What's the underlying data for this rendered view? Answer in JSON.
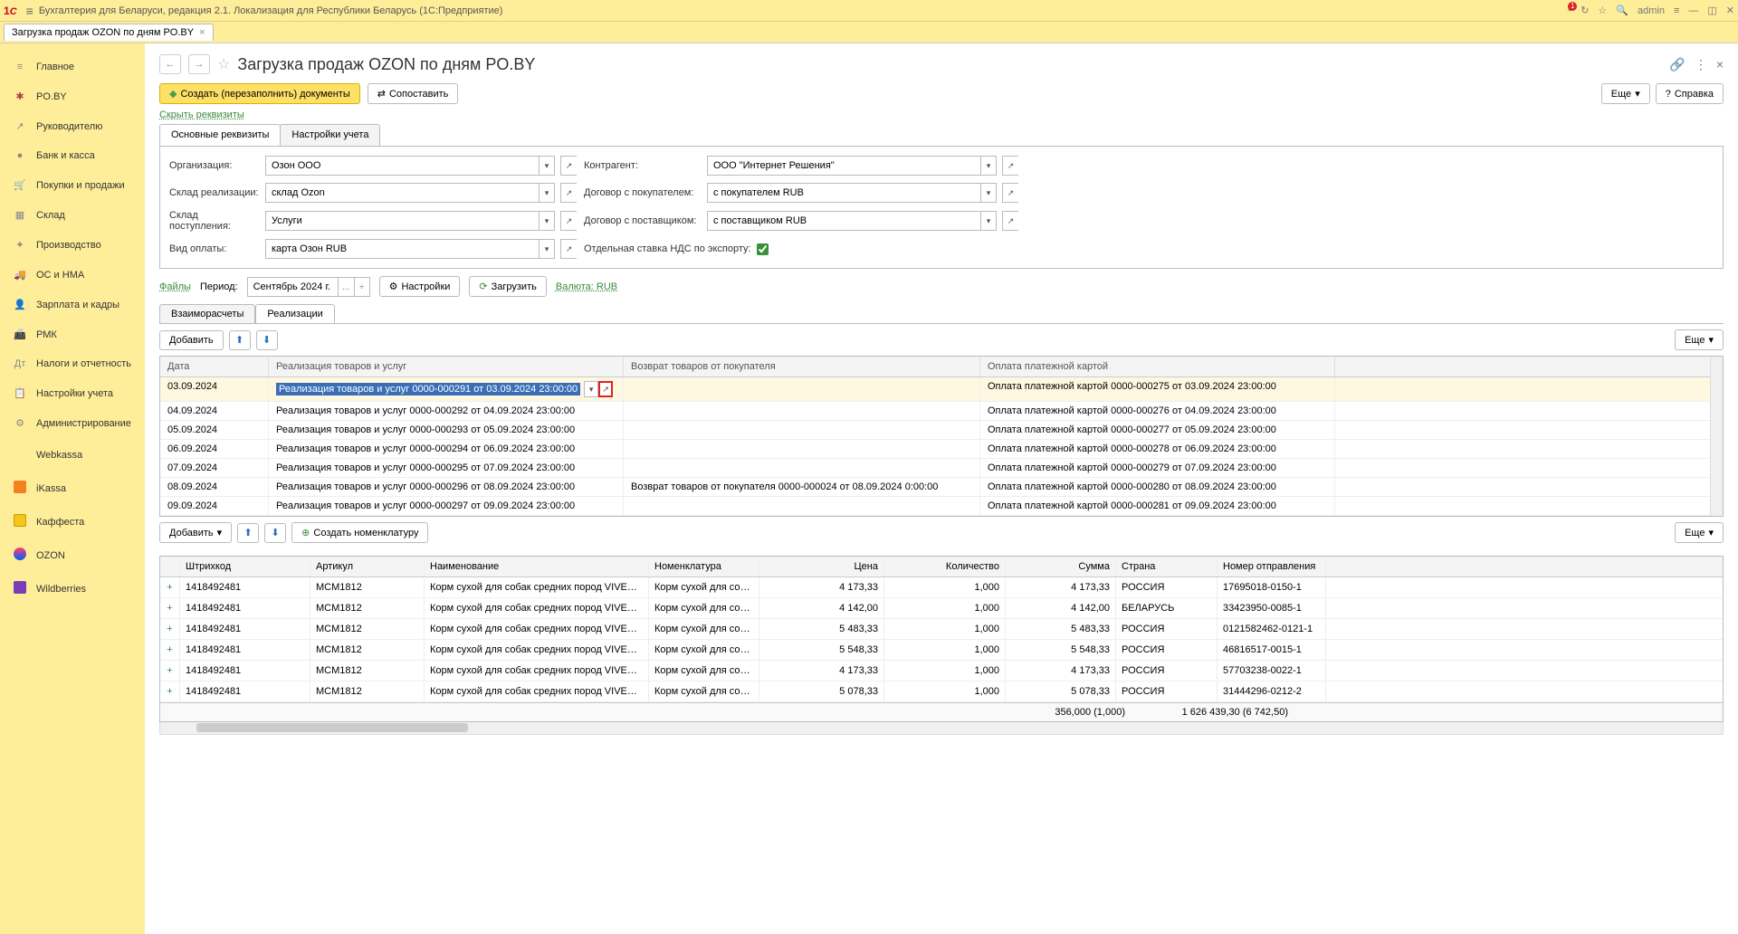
{
  "titlebar": {
    "brand": "1С",
    "title": "Бухгалтерия для Беларуси, редакция 2.1. Локализация для Республики Беларусь   (1С:Предприятие)",
    "user": "admin"
  },
  "tab": {
    "label": "Загрузка продаж OZON по дням PO.BY"
  },
  "sidebar": [
    {
      "icon": "≡",
      "cls": "gray",
      "label": "Главное"
    },
    {
      "icon": "✱",
      "cls": "red",
      "label": "PO.BY"
    },
    {
      "icon": "↗",
      "cls": "gray",
      "label": "Руководителю"
    },
    {
      "icon": "●",
      "cls": "gray",
      "label": "Банк и касса"
    },
    {
      "icon": "🛒",
      "cls": "red",
      "label": "Покупки и продажи"
    },
    {
      "icon": "▦",
      "cls": "gray",
      "label": "Склад"
    },
    {
      "icon": "✦",
      "cls": "gray",
      "label": "Производство"
    },
    {
      "icon": "🚚",
      "cls": "gray",
      "label": "ОС и НМА"
    },
    {
      "icon": "👤",
      "cls": "gray",
      "label": "Зарплата и кадры"
    },
    {
      "icon": "📠",
      "cls": "gray",
      "label": "РМК"
    },
    {
      "icon": "Дт",
      "cls": "gray",
      "label": "Налоги и отчетность"
    },
    {
      "icon": "📋",
      "cls": "red",
      "label": "Настройки учета"
    },
    {
      "icon": "⚙",
      "cls": "gray",
      "label": "Администрирование"
    },
    {
      "icon": "W",
      "cls": "red",
      "label": "Webkassa",
      "sq": "red",
      "sqStyle": "background:#b14040"
    },
    {
      "icon": "K",
      "cls": "orange",
      "label": "iKassa",
      "sq": "orange"
    },
    {
      "icon": "",
      "label": "Каффеста",
      "sq": "yellow"
    },
    {
      "icon": "",
      "label": "OZON",
      "sq": "ozon"
    },
    {
      "icon": "W",
      "label": "Wildberries",
      "sq": "purple"
    }
  ],
  "header": {
    "title": "Загрузка продаж OZON по дням PO.BY"
  },
  "toolbar": {
    "create": "Создать (перезаполнить) документы",
    "compare": "Сопоставить",
    "more": "Еще",
    "help": "Справка"
  },
  "hide_req": "Скрыть реквизиты",
  "req_tabs": {
    "t1": "Основные реквизиты",
    "t2": "Настройки учета"
  },
  "form": {
    "org_l": "Организация:",
    "org": "Озон ООО",
    "skl_r_l": "Склад реализации:",
    "skl_r": "склад Ozon",
    "skl_p_l": "Склад поступления:",
    "skl_p": "Услуги",
    "pay_l": "Вид оплаты:",
    "pay": "карта Озон RUB",
    "contr_l": "Контрагент:",
    "contr": "ООО \"Интернет Решения\"",
    "dog_b_l": "Договор с покупателем:",
    "dog_b": "с покупателем RUB",
    "dog_s_l": "Договор с поставщиком:",
    "dog_s": "с поставщиком RUB",
    "nds_l": "Отдельная ставка НДС по экспорту:"
  },
  "period": {
    "files": "Файлы",
    "period_l": "Период:",
    "period": "Сентябрь 2024 г.",
    "settings": "Настройки",
    "load": "Загрузить",
    "currency": "Валюта: RUB"
  },
  "inner_tabs": {
    "t1": "Взаиморасчеты",
    "t2": "Реализации"
  },
  "tb1": {
    "add": "Добавить",
    "more": "Еще"
  },
  "gcols": {
    "date": "Дата",
    "real": "Реализация товаров и услуг",
    "ret": "Возврат товаров от покупателя",
    "pay": "Оплата платежной картой"
  },
  "grows": [
    {
      "date": "03.09.2024",
      "real": "Реализация товаров и услуг 0000-000291 от 03.09.2024 23:00:00",
      "ret": "",
      "pay": "Оплата платежной картой 0000-000275 от 03.09.2024 23:00:00",
      "sel": true
    },
    {
      "date": "04.09.2024",
      "real": "Реализация товаров и услуг 0000-000292 от 04.09.2024 23:00:00",
      "ret": "",
      "pay": "Оплата платежной картой 0000-000276 от 04.09.2024 23:00:00"
    },
    {
      "date": "05.09.2024",
      "real": "Реализация товаров и услуг 0000-000293 от 05.09.2024 23:00:00",
      "ret": "",
      "pay": "Оплата платежной картой 0000-000277 от 05.09.2024 23:00:00"
    },
    {
      "date": "06.09.2024",
      "real": "Реализация товаров и услуг 0000-000294 от 06.09.2024 23:00:00",
      "ret": "",
      "pay": "Оплата платежной картой 0000-000278 от 06.09.2024 23:00:00"
    },
    {
      "date": "07.09.2024",
      "real": "Реализация товаров и услуг 0000-000295 от 07.09.2024 23:00:00",
      "ret": "",
      "pay": "Оплата платежной картой 0000-000279 от 07.09.2024 23:00:00"
    },
    {
      "date": "08.09.2024",
      "real": "Реализация товаров и услуг 0000-000296 от 08.09.2024 23:00:00",
      "ret": "Возврат товаров от покупателя 0000-000024 от 08.09.2024 0:00:00",
      "pay": "Оплата платежной картой 0000-000280 от 08.09.2024 23:00:00"
    },
    {
      "date": "09.09.2024",
      "real": "Реализация товаров и услуг 0000-000297 от 09.09.2024 23:00:00",
      "ret": "",
      "pay": "Оплата платежной картой 0000-000281 от 09.09.2024 23:00:00"
    }
  ],
  "tb2": {
    "add": "Добавить",
    "create_nom": "Создать номенклатуру",
    "more": "Еще"
  },
  "g2cols": {
    "bar": "Штрихкод",
    "art": "Артикул",
    "name": "Наименование",
    "nom": "Номенклатура",
    "price": "Цена",
    "qty": "Количество",
    "sum": "Сумма",
    "country": "Страна",
    "ship": "Номер отправления"
  },
  "g2rows": [
    {
      "bar": "1418492481",
      "art": "MCM1812",
      "name": "Корм сухой для собак средних пород VIVERE ...",
      "nom": "Корм сухой для соба...",
      "price": "4 173,33",
      "qty": "1,000",
      "sum": "4 173,33",
      "country": "РОССИЯ",
      "ship": "17695018-0150-1"
    },
    {
      "bar": "1418492481",
      "art": "MCM1812",
      "name": "Корм сухой для собак средних пород VIVERE ...",
      "nom": "Корм сухой для соба...",
      "price": "4 142,00",
      "qty": "1,000",
      "sum": "4 142,00",
      "country": "БЕЛАРУСЬ",
      "ship": "33423950-0085-1"
    },
    {
      "bar": "1418492481",
      "art": "MCM1812",
      "name": "Корм сухой для собак средних пород VIVERE ...",
      "nom": "Корм сухой для соба...",
      "price": "5 483,33",
      "qty": "1,000",
      "sum": "5 483,33",
      "country": "РОССИЯ",
      "ship": "0121582462-0121-1"
    },
    {
      "bar": "1418492481",
      "art": "MCM1812",
      "name": "Корм сухой для собак средних пород VIVERE ...",
      "nom": "Корм сухой для соба...",
      "price": "5 548,33",
      "qty": "1,000",
      "sum": "5 548,33",
      "country": "РОССИЯ",
      "ship": "46816517-0015-1"
    },
    {
      "bar": "1418492481",
      "art": "MCM1812",
      "name": "Корм сухой для собак средних пород VIVERE ...",
      "nom": "Корм сухой для соба...",
      "price": "4 173,33",
      "qty": "1,000",
      "sum": "4 173,33",
      "country": "РОССИЯ",
      "ship": "57703238-0022-1"
    },
    {
      "bar": "1418492481",
      "art": "MCM1812",
      "name": "Корм сухой для собак средних пород VIVERE ...",
      "nom": "Корм сухой для соба...",
      "price": "5 078,33",
      "qty": "1,000",
      "sum": "5 078,33",
      "country": "РОССИЯ",
      "ship": "31444296-0212-2"
    }
  ],
  "totals": {
    "qty": "356,000 (1,000)",
    "sum": "1 626 439,30 (6 742,50)"
  }
}
